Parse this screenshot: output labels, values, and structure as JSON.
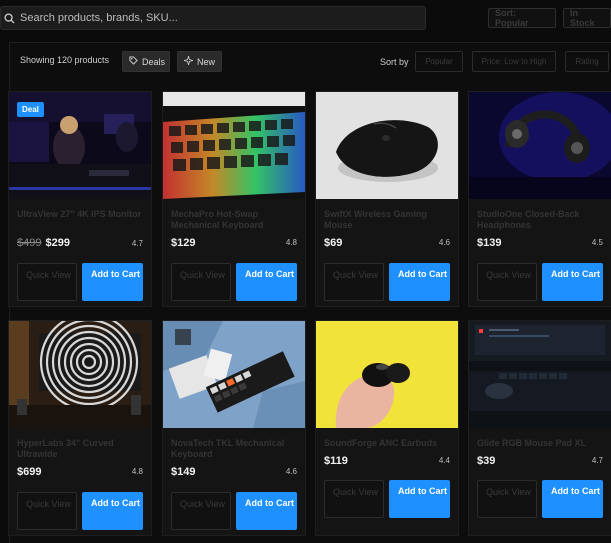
{
  "search": {
    "placeholder": "Search products, brands, SKU..."
  },
  "top_pills": {
    "sort": "Sort: Popular",
    "stock": "In Stock"
  },
  "toolbar": {
    "showing": "Showing 120 products",
    "chips": [
      "Deals",
      "New"
    ],
    "sort_label": "Sort by",
    "sort_options": [
      "Popular",
      "Price: Low to High",
      "Rating"
    ]
  },
  "products": [
    {
      "title": "UltraView 27\" 4K IPS Monitor",
      "old_price": "$499",
      "price": "$299",
      "rating": "4.7",
      "badge": "Deal",
      "quick_view": "Quick View",
      "add_to_cart": "Add to Cart"
    },
    {
      "title": "MechaPro Hot-Swap Mechanical Keyboard",
      "old_price": "",
      "price": "$129",
      "rating": "4.8",
      "badge": "",
      "quick_view": "Quick View",
      "add_to_cart": "Add to Cart"
    },
    {
      "title": "SwiftX Wireless Gaming Mouse",
      "old_price": "",
      "price": "$69",
      "rating": "4.6",
      "badge": "",
      "quick_view": "Quick View",
      "add_to_cart": "Add to Cart"
    },
    {
      "title": "StudioOne Closed-Back Headphones",
      "old_price": "",
      "price": "$139",
      "rating": "4.5",
      "badge": "",
      "quick_view": "Quick View",
      "add_to_cart": "Add to Cart"
    },
    {
      "title": "HyperLabs 34\" Curved Ultrawide",
      "old_price": "",
      "price": "$699",
      "rating": "4.8",
      "badge": "",
      "quick_view": "Quick View",
      "add_to_cart": "Add to Cart"
    },
    {
      "title": "NovaTech TKL Mechanical Keyboard",
      "old_price": "",
      "price": "$149",
      "rating": "4.6",
      "badge": "",
      "quick_view": "Quick View",
      "add_to_cart": "Add to Cart"
    },
    {
      "title": "SoundForge ANC Earbuds",
      "old_price": "",
      "price": "$119",
      "rating": "4.4",
      "badge": "",
      "quick_view": "Quick View",
      "add_to_cart": "Add to Cart"
    },
    {
      "title": "Glide RGB Mouse Pad XL",
      "old_price": "",
      "price": "$39",
      "rating": "4.7",
      "badge": "",
      "quick_view": "Quick View",
      "add_to_cart": "Add to Cart"
    }
  ]
}
